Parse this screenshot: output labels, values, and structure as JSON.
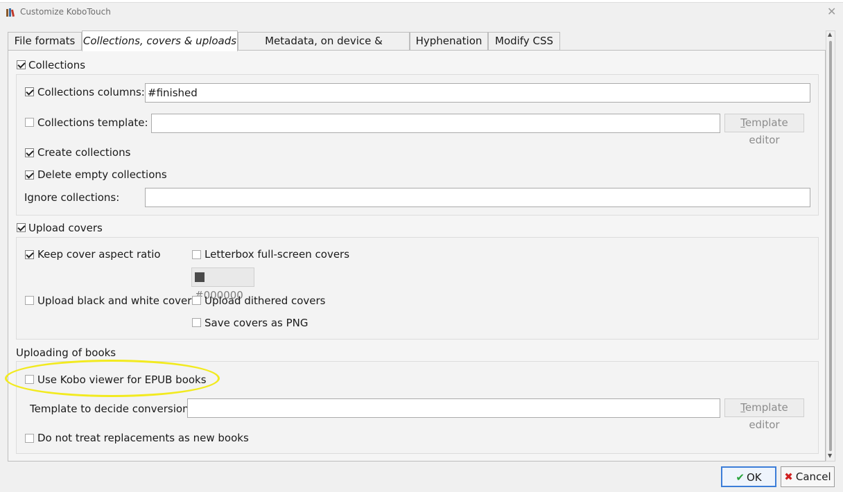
{
  "window": {
    "title": "Customize KoboTouch",
    "close_glyph": "✕"
  },
  "tabs": [
    {
      "label": "File formats"
    },
    {
      "label": "Collections, covers & uploads"
    },
    {
      "label": "Metadata, on device & advanced"
    },
    {
      "label": "Hyphenation"
    },
    {
      "label": "Modify CSS"
    }
  ],
  "collections": {
    "header_label": "Collections",
    "header_checked": true,
    "columns_label": "Collections columns:",
    "columns_checked": true,
    "columns_value": "#finished",
    "template_label": "Collections template:",
    "template_checked": false,
    "template_value": "",
    "template_editor_prefix": "T",
    "template_editor_rest": "emplate editor",
    "create_label": "Create collections",
    "create_checked": true,
    "delete_empty_label": "Delete empty collections",
    "delete_empty_checked": true,
    "ignore_label": "Ignore collections:",
    "ignore_value": ""
  },
  "covers": {
    "header_label": "Upload covers",
    "header_checked": true,
    "keep_aspect_label": "Keep cover aspect ratio",
    "keep_aspect_checked": true,
    "letterbox_label": "Letterbox full-screen covers",
    "letterbox_checked": false,
    "letterbox_color": "#000000",
    "bw_label": "Upload black and white covers",
    "bw_checked": false,
    "dithered_label": "Upload dithered covers",
    "dithered_checked": false,
    "png_label": "Save covers as PNG",
    "png_checked": false
  },
  "uploading": {
    "section_label": "Uploading of books",
    "kobo_viewer_label": "Use Kobo viewer for EPUB books",
    "kobo_viewer_checked": false,
    "conversion_label": "Template to decide conversion:",
    "conversion_value": "",
    "template_editor_prefix": "T",
    "template_editor_rest": "emplate editor",
    "no_replace_label": "Do not treat replacements as new books",
    "no_replace_checked": false
  },
  "buttons": {
    "ok_label": "OK",
    "ok_glyph": "✔",
    "cancel_label": "Cancel",
    "cancel_glyph": "✖"
  },
  "colors": {
    "highlight": "#f2ea1f",
    "default_button_border": "#3b7dd8"
  },
  "icons": {
    "app": "calibre-books-icon",
    "ok": "check-icon",
    "cancel": "x-icon"
  }
}
